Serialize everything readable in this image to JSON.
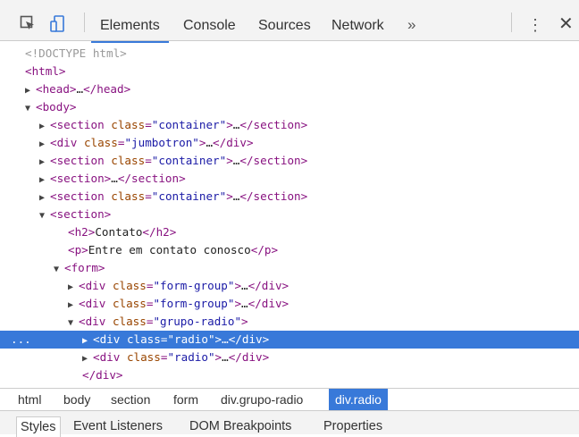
{
  "toolbar": {
    "tabs": [
      "Elements",
      "Console",
      "Sources",
      "Network"
    ],
    "more": "»",
    "menu": "⋮",
    "close": "✕"
  },
  "tree": [
    {
      "pre": "<!DOCTYPE html>"
    },
    {
      "tag_open": "<html>"
    },
    {
      "tri": "▶",
      "tag_open": "<head>",
      "dots": "…",
      "tag_close": "</head>"
    },
    {
      "tri": "▼",
      "tag_open": "<body>"
    },
    {
      "tri": "▶",
      "tag_name": "<section",
      "attr": "class",
      "val": "\"container\"",
      "tag_end": ">",
      "dots": "…",
      "tag_close": "</section>"
    },
    {
      "tri": "▶",
      "tag_name": "<div",
      "attr": "class",
      "val": "\"jumbotron\"",
      "tag_end": ">",
      "dots": "…",
      "tag_close": "</div>"
    },
    {
      "tri": "▶",
      "tag_name": "<section",
      "attr": "class",
      "val": "\"container\"",
      "tag_end": ">",
      "dots": "…",
      "tag_close": "</section>"
    },
    {
      "tri": "▶",
      "tag_open": "<section>",
      "dots": "…",
      "tag_close": "</section>"
    },
    {
      "tri": "▶",
      "tag_name": "<section",
      "attr": "class",
      "val": "\"container\"",
      "tag_end": ">",
      "dots": "…",
      "tag_close": "</section>"
    },
    {
      "tri": "▼",
      "tag_open": "<section>"
    },
    {
      "tag_open": "<h2>",
      "text": "Contato",
      "tag_close": "</h2>"
    },
    {
      "tag_open": "<p>",
      "text": "Entre em contato conosco",
      "tag_close": "</p>"
    },
    {
      "tri": "▼",
      "tag_open": "<form>"
    },
    {
      "tri": "▶",
      "tag_name": "<div",
      "attr": "class",
      "val": "\"form-group\"",
      "tag_end": ">",
      "dots": "…",
      "tag_close": "</div>"
    },
    {
      "tri": "▶",
      "tag_name": "<div",
      "attr": "class",
      "val": "\"form-group\"",
      "tag_end": ">",
      "dots": "…",
      "tag_close": "</div>"
    },
    {
      "tri": "▼",
      "tag_name": "<div",
      "attr": "class",
      "val": "\"grupo-radio\"",
      "tag_end": ">"
    },
    {
      "tri": "▶",
      "tag_name": "<div",
      "attr": "class",
      "val": "\"radio\"",
      "tag_end": ">",
      "dots": "…",
      "tag_close": "</div>",
      "marker": "..."
    },
    {
      "tri": "▶",
      "tag_name": "<div",
      "attr": "class",
      "val": "\"radio\"",
      "tag_end": ">",
      "dots": "…",
      "tag_close": "</div>"
    },
    {
      "tag_close": "</div>"
    }
  ],
  "breadcrumbs": [
    "html",
    "body",
    "section",
    "form",
    "div.grupo-radio",
    "div.radio"
  ],
  "subtabs": [
    "Styles",
    "Event Listeners",
    "DOM Breakpoints",
    "Properties"
  ],
  "colors": {
    "accent": "#3879d9",
    "tag": "#881280",
    "attr": "#994500",
    "value": "#1a1aa6"
  }
}
